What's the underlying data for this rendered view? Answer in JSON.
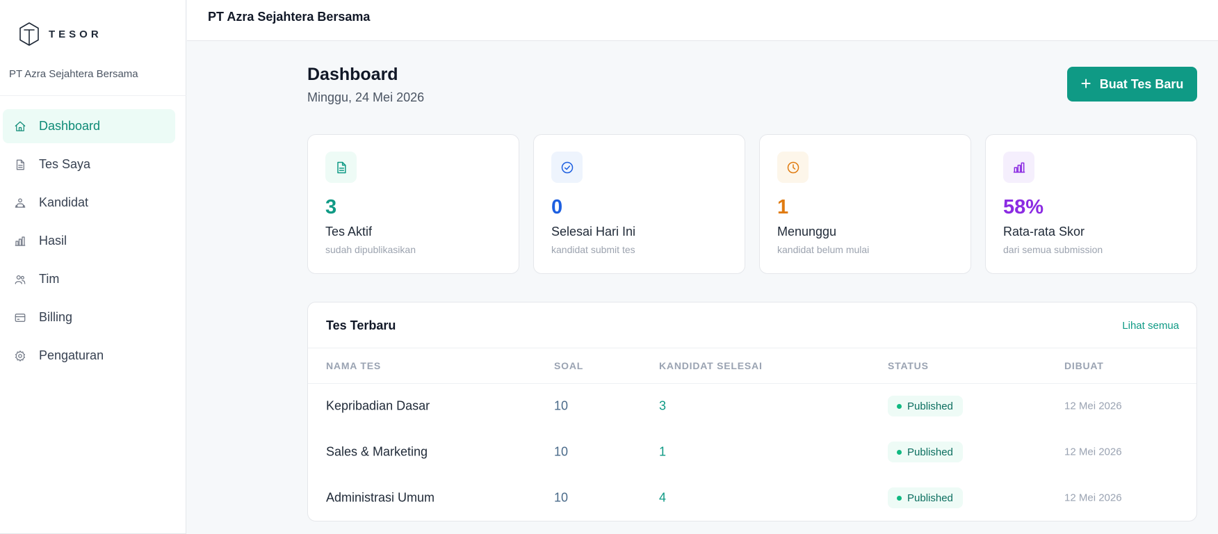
{
  "app": {
    "logo_text": "TESOR",
    "org_name": "PT Azra Sejahtera Bersama"
  },
  "topbar": {
    "title": "PT Azra Sejahtera Bersama"
  },
  "sidebar": {
    "items": [
      {
        "label": "Dashboard",
        "icon": "home-icon",
        "active": true
      },
      {
        "label": "Tes Saya",
        "icon": "document-icon"
      },
      {
        "label": "Kandidat",
        "icon": "candidate-icon"
      },
      {
        "label": "Hasil",
        "icon": "bar-chart-icon"
      },
      {
        "label": "Tim",
        "icon": "users-icon"
      },
      {
        "label": "Billing",
        "icon": "credit-card-icon"
      },
      {
        "label": "Pengaturan",
        "icon": "gear-icon"
      }
    ]
  },
  "header": {
    "title": "Dashboard",
    "date": "Minggu, 24 Mei 2026",
    "new_button": "Buat Tes Baru"
  },
  "stats": [
    {
      "value": "3",
      "label": "Tes Aktif",
      "sub": "sudah dipublikasikan",
      "color": "#0f9a85",
      "bg": "#eefbf6",
      "icon": "document-icon"
    },
    {
      "value": "0",
      "label": "Selesai Hari Ini",
      "sub": "kandidat submit tes",
      "color": "#1d5fe0",
      "bg": "#eef4fd",
      "icon": "check-circle-icon"
    },
    {
      "value": "1",
      "label": "Menunggu",
      "sub": "kandidat belum mulai",
      "color": "#e07b10",
      "bg": "#fdf6ea",
      "icon": "clock-icon"
    },
    {
      "value": "58%",
      "label": "Rata-rata Skor",
      "sub": "dari semua submission",
      "color": "#8b2be2",
      "bg": "#f5effd",
      "icon": "bar-chart-icon"
    }
  ],
  "table": {
    "title": "Tes Terbaru",
    "link": "Lihat semua",
    "columns": [
      "NAMA TES",
      "SOAL",
      "KANDIDAT SELESAI",
      "STATUS",
      "DIBUAT"
    ],
    "rows": [
      {
        "name": "Kepribadian Dasar",
        "soal": "10",
        "done": "3",
        "status": "Published",
        "date": "12 Mei 2026"
      },
      {
        "name": "Sales & Marketing",
        "soal": "10",
        "done": "1",
        "status": "Published",
        "date": "12 Mei 2026"
      },
      {
        "name": "Administrasi Umum",
        "soal": "10",
        "done": "4",
        "status": "Published",
        "date": "12 Mei 2026"
      }
    ]
  }
}
